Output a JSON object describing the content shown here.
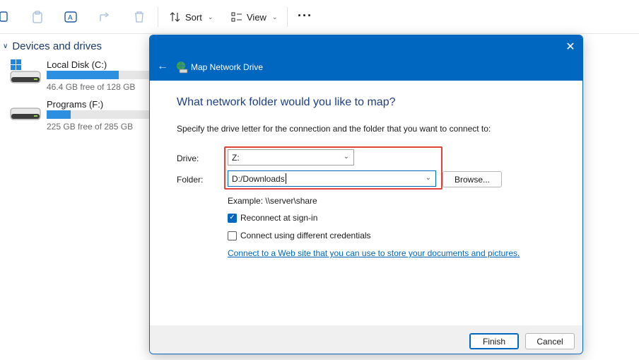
{
  "toolbar": {
    "sort_label": "Sort",
    "view_label": "View",
    "icons": [
      "new-icon",
      "paste-icon",
      "rename-icon",
      "share-icon",
      "delete-icon",
      "sort-icon",
      "view-icon",
      "more-icon"
    ]
  },
  "explorer": {
    "section_title": "Devices and drives",
    "drives": [
      {
        "name": "Local Disk (C:)",
        "free_text": "46.4 GB free of 128 GB",
        "used_fraction": 0.64,
        "icon": "windows-drive-icon"
      },
      {
        "name": "Programs (F:)",
        "free_text": "225 GB free of 285 GB",
        "used_fraction": 0.21,
        "icon": "hard-drive-icon"
      }
    ]
  },
  "dialog": {
    "title": "Map Network Drive",
    "heading": "What network folder would you like to map?",
    "instruction": "Specify the drive letter for the connection and the folder that you want to connect to:",
    "drive_label": "Drive:",
    "drive_value": "Z:",
    "folder_label": "Folder:",
    "folder_value": "D:/Downloads",
    "browse_label": "Browse...",
    "example_text": "Example: \\\\server\\share",
    "reconnect_label": "Reconnect at sign-in",
    "reconnect_checked": true,
    "credentials_label": "Connect using different credentials",
    "credentials_checked": false,
    "link_text": "Connect to a Web site that you can use to store your documents and pictures",
    "link_suffix": ".",
    "finish_label": "Finish",
    "cancel_label": "Cancel"
  },
  "colors": {
    "accent": "#0067c0",
    "highlight": "#e0423f",
    "heading": "#1f3f83",
    "drive_bar": "#2d8fe0"
  }
}
